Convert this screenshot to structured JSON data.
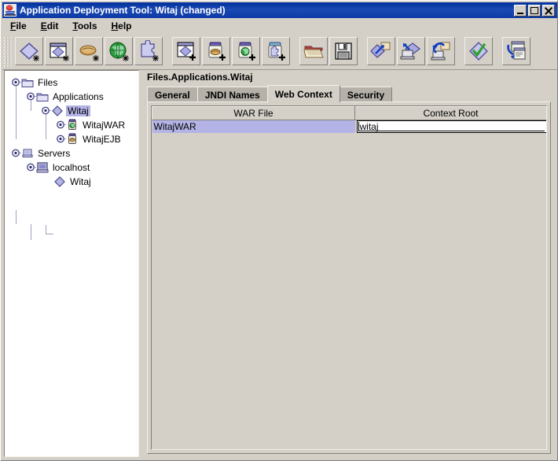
{
  "window": {
    "title": "Application Deployment Tool: Witaj (changed)",
    "icon": "app-duke-icon",
    "buttons": {
      "minimize": "_",
      "maximize": "□",
      "close": "✕"
    }
  },
  "menubar": {
    "items": [
      {
        "label": "File",
        "mnemonic": "F"
      },
      {
        "label": "Edit",
        "mnemonic": "E"
      },
      {
        "label": "Tools",
        "mnemonic": "T"
      },
      {
        "label": "Help",
        "mnemonic": "H"
      }
    ]
  },
  "toolbar": {
    "groups": [
      {
        "buttons": [
          {
            "name": "new-application-button",
            "icon": "diamond-new-icon"
          },
          {
            "name": "new-application-client-button",
            "icon": "diamond-in-window-new-icon"
          },
          {
            "name": "new-ejb-jar-button",
            "icon": "bean-new-icon"
          },
          {
            "name": "new-web-war-button",
            "icon": "globe-new-icon"
          },
          {
            "name": "new-connector-button",
            "icon": "puzzle-new-icon"
          }
        ]
      },
      {
        "buttons": [
          {
            "name": "add-application-client-button",
            "icon": "diamond-window-plus-icon"
          },
          {
            "name": "add-ejb-jar-button",
            "icon": "jar-bean-plus-icon"
          },
          {
            "name": "add-war-button",
            "icon": "jar-globe-plus-icon"
          },
          {
            "name": "add-connector-button",
            "icon": "jar-puzzle-plus-icon"
          }
        ]
      },
      {
        "buttons": [
          {
            "name": "open-button",
            "icon": "folder-open-icon"
          },
          {
            "name": "save-button",
            "icon": "floppy-disk-icon"
          }
        ]
      },
      {
        "buttons": [
          {
            "name": "deploy-button",
            "icon": "deploy-arrow-icon"
          },
          {
            "name": "deploy-to-client-button",
            "icon": "deploy-client-icon"
          },
          {
            "name": "undeploy-button",
            "icon": "undeploy-arrow-icon"
          }
        ]
      },
      {
        "buttons": [
          {
            "name": "verify-button",
            "icon": "diamond-check-icon"
          }
        ]
      },
      {
        "buttons": [
          {
            "name": "export-button",
            "icon": "window-export-icon"
          }
        ]
      }
    ]
  },
  "tree": {
    "nodes": [
      {
        "label": "Files",
        "icon": "folder-icon",
        "depth": 0,
        "expanded": true,
        "selected": false,
        "handle": true
      },
      {
        "label": "Applications",
        "icon": "folder-icon",
        "depth": 1,
        "expanded": true,
        "selected": false,
        "handle": true
      },
      {
        "label": "Witaj",
        "icon": "diamond-icon",
        "depth": 2,
        "expanded": true,
        "selected": true,
        "handle": true
      },
      {
        "label": "WitajWAR",
        "icon": "jar-globe-icon",
        "depth": 3,
        "expanded": false,
        "selected": false,
        "handle": true
      },
      {
        "label": "WitajEJB",
        "icon": "jar-bean-icon",
        "depth": 3,
        "expanded": false,
        "selected": false,
        "handle": true
      },
      {
        "label": "Servers",
        "icon": "server-small-icon",
        "depth": 0,
        "expanded": true,
        "selected": false,
        "handle": true
      },
      {
        "label": "localhost",
        "icon": "server-icon",
        "depth": 1,
        "expanded": true,
        "selected": false,
        "handle": true
      },
      {
        "label": "Witaj",
        "icon": "diamond-icon",
        "depth": 2,
        "expanded": false,
        "selected": false,
        "handle": false
      }
    ]
  },
  "main": {
    "breadcrumb": "Files.Applications.Witaj",
    "tabs": [
      {
        "label": "General",
        "active": false
      },
      {
        "label": "JNDI Names",
        "active": false
      },
      {
        "label": "Web Context",
        "active": true
      },
      {
        "label": "Security",
        "active": false
      }
    ],
    "table": {
      "columns": [
        "WAR File",
        "Context Root"
      ],
      "rows": [
        {
          "war_file": "WitajWAR",
          "context_root": "witaj",
          "selected": true,
          "editing": true
        }
      ]
    }
  },
  "colors": {
    "titlebar": "#103fa8",
    "control": "#d4d0c8",
    "selection": "#b3b3e6",
    "tab_inactive": "#b5b1a9",
    "field": "#ffffff"
  }
}
